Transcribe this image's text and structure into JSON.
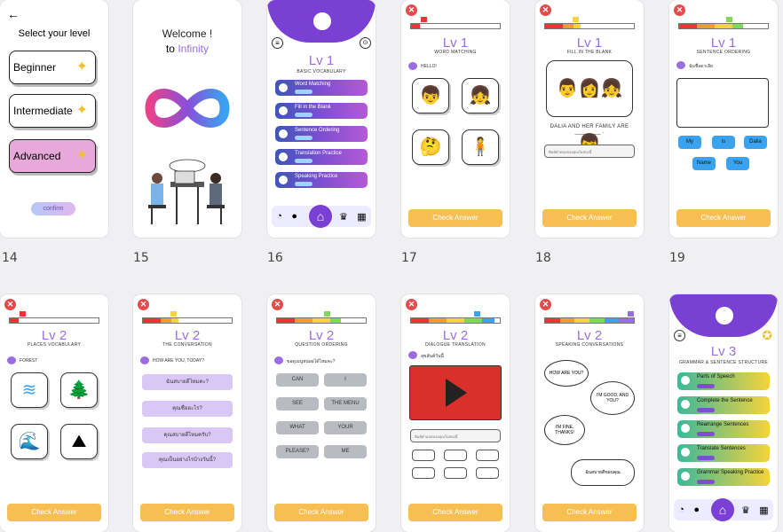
{
  "indices": [
    "14",
    "15",
    "16",
    "17",
    "18",
    "19"
  ],
  "c14": {
    "title": "Select your level",
    "levels": [
      "Beginner",
      "Intermediate",
      "Advanced"
    ],
    "confirm": "confirm"
  },
  "c15": {
    "welcome": "Welcome !",
    "to": "to",
    "app": "Infinity"
  },
  "c16": {
    "level": "Lv 1",
    "subtitle": "BASIC VOCABULARY",
    "lessons": [
      "Word Matching",
      "Fill in the Blank",
      "Sentence Ordering",
      "Translation Practice",
      "Speaking Practice"
    ]
  },
  "c17": {
    "level": "Lv 1",
    "subtitle": "WORD MATCHING",
    "prompt": "HELLO!"
  },
  "c18": {
    "level": "Lv 1",
    "subtitle": "FILL IN THE BLANK",
    "sentence": "DALIA AND HER FAMILY ARE ________ .",
    "answer_placeholder": "พิมพ์คำตอบของคุณในช่องนี้"
  },
  "c19": {
    "level": "Lv 1",
    "subtitle": "SENTENCE ORDERING",
    "prompt": "ฉันชื่อดาเลีย",
    "words": [
      "My",
      "is",
      "Dalia",
      "Name",
      "You"
    ]
  },
  "c20": {
    "level": "Lv 2",
    "subtitle": "PLACES VOCABULARY",
    "prompt": "FOREST"
  },
  "c21": {
    "level": "Lv 2",
    "subtitle": "THE CONVERSATION",
    "prompt": "HOW ARE YOU, TODAY?",
    "options": [
      "ฉันสบายดีไหมคะ?",
      "คุณชื่ออะไร?",
      "คุณสบายดีไหมครับ?",
      "คุณเป็นอย่างไรบ้างวันนี้?"
    ]
  },
  "c22": {
    "level": "Lv 2",
    "subtitle": "QUESTION ORDERING",
    "prompt": "ขอดูเมนูหน่อยได้ไหมคะ?",
    "words": [
      "CAN",
      "I",
      "SEE",
      "THE MENU",
      "WHAT",
      "YOUR",
      "PLEASE?",
      "ME"
    ]
  },
  "c23": {
    "level": "Lv 2",
    "subtitle": "DIALOGUE TRANSLATION",
    "prompt": "สุขสันต์วันนี้",
    "answer_placeholder": "พิมพ์คำแปลของคุณในช่องนี้"
  },
  "c24": {
    "level": "Lv 2",
    "subtitle": "SPEAKING CONVERSATIONS",
    "bubbles": [
      "HOW ARE YOU?",
      "I'M GOOD, AND YOU?",
      "I'M FINE, THANKS!",
      "ฉันสบายดีขอบคุณ"
    ]
  },
  "c25": {
    "level": "Lv 3",
    "subtitle": "GRAMMAR & SENTENCE STRUCTURE",
    "lessons": [
      "Parts of Speech",
      "Complete the Sentence",
      "Rearrange Sentences",
      "Translate Sentences",
      "Grammar Speaking Practice"
    ]
  },
  "check": "Check Answer",
  "play": "PLAY"
}
